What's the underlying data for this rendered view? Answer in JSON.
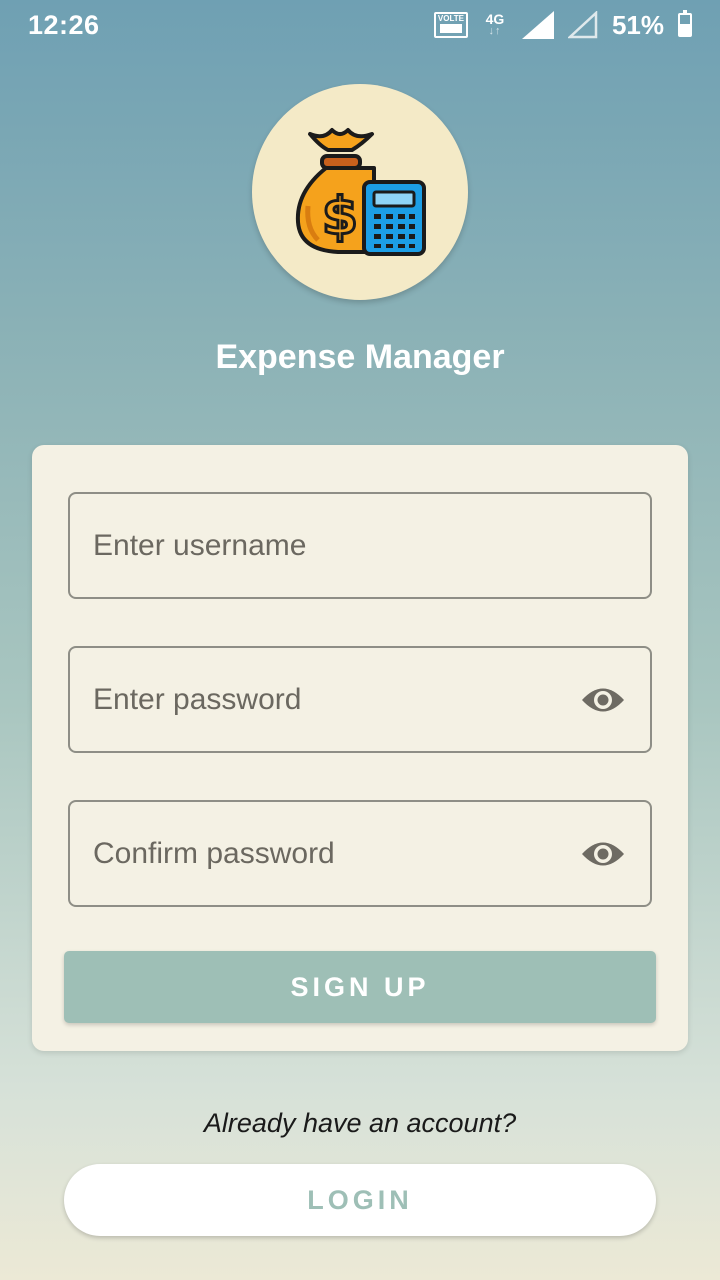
{
  "status_bar": {
    "time": "12:26",
    "volte_label": "VOLTE",
    "network_label": "4G",
    "battery_percent": "51%",
    "battery_level": 0.51
  },
  "app": {
    "title": "Expense Manager",
    "logo_icon": "money-bag-calculator-icon"
  },
  "form": {
    "username_placeholder": "Enter username",
    "password_placeholder": "Enter password",
    "confirm_password_placeholder": "Confirm password",
    "signup_label": "SIGN UP"
  },
  "footer": {
    "already_text": "Already have an account?",
    "login_label": "LOGIN"
  },
  "colors": {
    "accent": "#9ebfb6",
    "card_bg": "#f4f1e4",
    "logo_bg": "#f4eac7"
  }
}
